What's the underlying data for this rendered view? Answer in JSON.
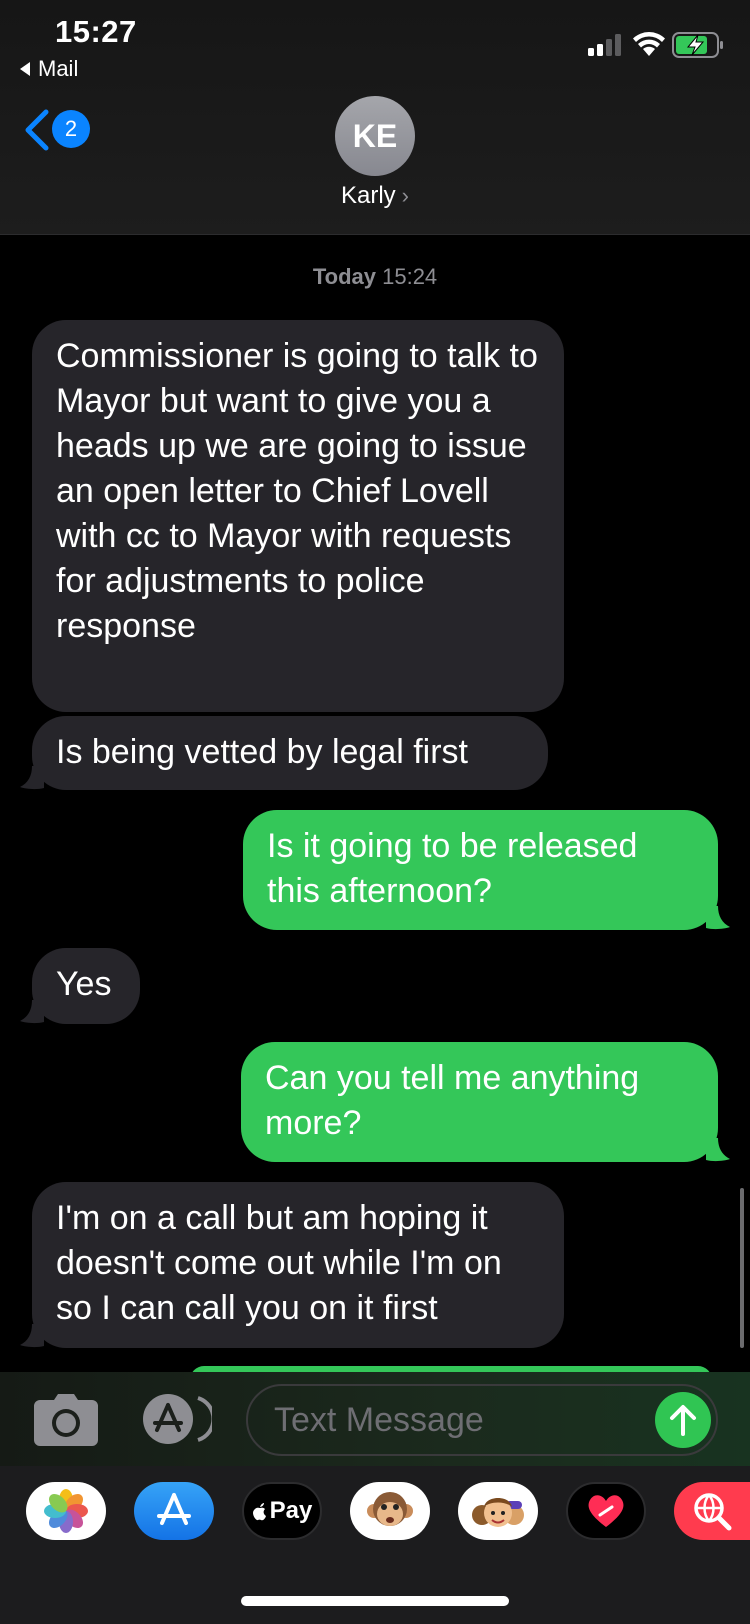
{
  "status_bar": {
    "time": "15:27",
    "back_app": "Mail"
  },
  "header": {
    "unread_count": "2",
    "avatar_initials": "KE",
    "contact_name": "Karly",
    "contact_chevron": "›"
  },
  "thread": {
    "timestamp_day": "Today",
    "timestamp_time": "15:24",
    "messages": [
      {
        "direction": "incoming",
        "text": "Commissioner is going to talk to Mayor but want to give you a heads up we are going to issue an open letter to Chief Lovell with cc to Mayor with requests for adjustments to police response"
      },
      {
        "direction": "incoming",
        "text": "Is being vetted by legal first"
      },
      {
        "direction": "outgoing",
        "text": "Is it going to be released this afternoon?"
      },
      {
        "direction": "incoming",
        "text": "Yes"
      },
      {
        "direction": "outgoing",
        "text": "Can you tell me anything more?"
      },
      {
        "direction": "incoming",
        "text": "I'm on a call but am hoping it doesn't come out while I'm on so I can call you on it first"
      }
    ]
  },
  "compose": {
    "placeholder": "Text Message",
    "camera_icon": "camera-icon",
    "apps_icon": "app-store-icon",
    "send_icon": "arrow-up-icon"
  },
  "app_drawer": [
    {
      "name": "photos",
      "icon": "photos-icon"
    },
    {
      "name": "app-store",
      "icon": "app-store-icon"
    },
    {
      "name": "apple-pay",
      "label": "Pay",
      "icon": "apple-pay-icon"
    },
    {
      "name": "animoji",
      "icon": "monkey-icon"
    },
    {
      "name": "memoji",
      "icon": "memoji-icon"
    },
    {
      "name": "digital-touch",
      "icon": "heart-icon"
    },
    {
      "name": "search-images",
      "icon": "globe-search-icon"
    }
  ],
  "colors": {
    "outgoing": "#34c759",
    "incoming": "#26252a",
    "accent": "#0a84ff"
  }
}
